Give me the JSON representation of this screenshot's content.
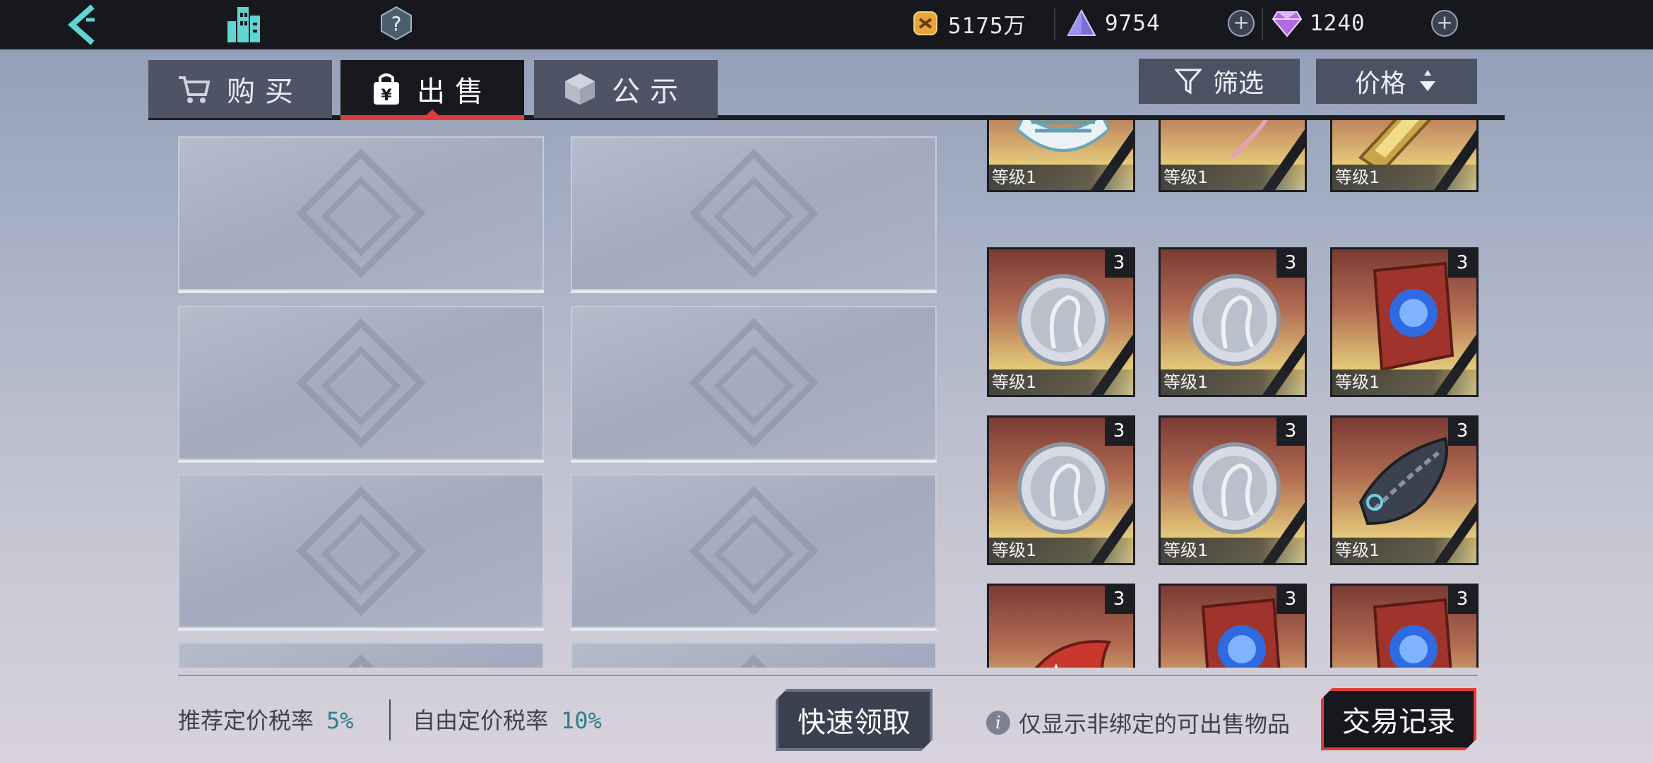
{
  "topbar": {
    "gold": "5175万",
    "crystal": "9754",
    "gem": "1240"
  },
  "tabs": [
    {
      "label": "购买",
      "icon": "cart-icon"
    },
    {
      "label": "出售",
      "icon": "shopping-bag-yen-icon"
    },
    {
      "label": "公示",
      "icon": "cube-icon"
    }
  ],
  "toolbar": {
    "filter_label": "筛选",
    "sort_label": "价格"
  },
  "items": [
    {
      "level": "等级1",
      "qty": "",
      "icon": "bikini-top-icon"
    },
    {
      "level": "等级1",
      "qty": "",
      "icon": "necklace-icon"
    },
    {
      "level": "等级1",
      "qty": "",
      "icon": "ruler-icon"
    },
    {
      "level": "等级1",
      "qty": "3",
      "icon": "silver-coin-icon"
    },
    {
      "level": "等级1",
      "qty": "3",
      "icon": "silver-coin-icon"
    },
    {
      "level": "等级1",
      "qty": "3",
      "icon": "rune-card-icon"
    },
    {
      "level": "等级1",
      "qty": "3",
      "icon": "silver-coin-icon"
    },
    {
      "level": "等级1",
      "qty": "3",
      "icon": "silver-coin-icon"
    },
    {
      "level": "等级1",
      "qty": "3",
      "icon": "fish-icon"
    },
    {
      "level": "",
      "qty": "3",
      "icon": "witch-hat-icon"
    },
    {
      "level": "",
      "qty": "3",
      "icon": "rune-card-icon"
    },
    {
      "level": "",
      "qty": "3",
      "icon": "rune-card-icon"
    }
  ],
  "footer": {
    "recommended_tax_label": "推荐定价税率",
    "recommended_tax_value": "5%",
    "free_tax_label": "自由定价税率",
    "free_tax_value": "10%",
    "quick_claim_label": "快速领取",
    "note": "仅显示非绑定的可出售物品",
    "trade_record_label": "交易记录"
  },
  "colors": {
    "accent_red": "#e03a3a",
    "tax_value": "#2f7e8c",
    "topbar_bg": "#16181d"
  }
}
